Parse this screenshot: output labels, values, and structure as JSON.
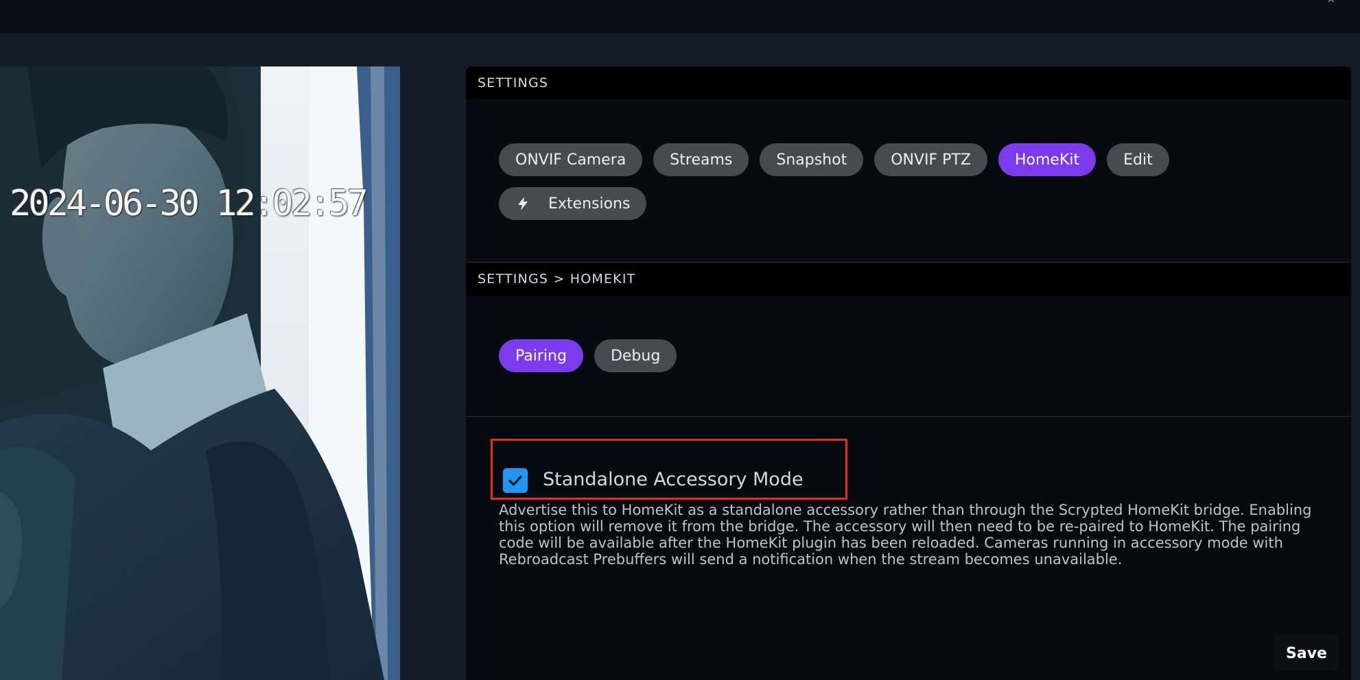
{
  "topbar": {
    "corner_icon": "close-icon"
  },
  "snapshot": {
    "timestamp": "2024-06-30 12:02:57"
  },
  "settings": {
    "header": "SETTINGS",
    "tabs": [
      {
        "label": "ONVIF Camera",
        "active": false
      },
      {
        "label": "Streams",
        "active": false
      },
      {
        "label": "Snapshot",
        "active": false
      },
      {
        "label": "ONVIF PTZ",
        "active": false
      },
      {
        "label": "HomeKit",
        "active": true
      },
      {
        "label": "Edit",
        "active": false
      },
      {
        "label": "Extensions",
        "active": false,
        "icon": "lightning-bolt-icon"
      }
    ]
  },
  "homekit": {
    "header": "SETTINGS > HOMEKIT",
    "tabs": [
      {
        "label": "Pairing",
        "active": true
      },
      {
        "label": "Debug",
        "active": false
      }
    ]
  },
  "standalone": {
    "checked": true,
    "label": "Standalone Accessory Mode",
    "description": "Advertise this to HomeKit as a standalone accessory rather than through the Scrypted HomeKit bridge. Enabling this option will remove it from the bridge. The accessory will then need to be re-paired to HomeKit. The pairing code will be available after the HomeKit plugin has been reloaded. Cameras running in accessory mode with Rebroadcast Prebuffers will send a notification when the stream becomes unavailable."
  },
  "footer": {
    "save_label": "Save"
  },
  "colors": {
    "accent": "#7c3aed",
    "chip": "#474a4f",
    "checkbox": "#2196f3",
    "highlight": "#e8291c",
    "panel": "#070a0e",
    "background": "#141c28"
  }
}
